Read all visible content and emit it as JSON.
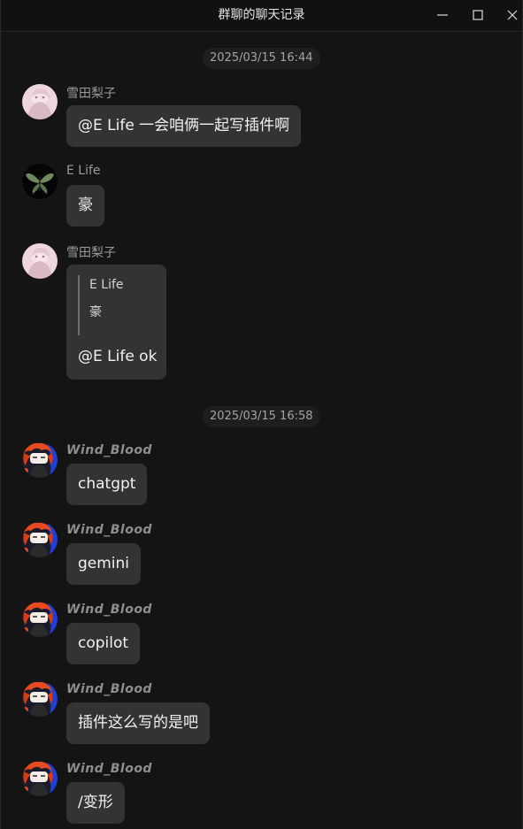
{
  "window": {
    "title": "群聊的聊天记录"
  },
  "timestamps": [
    "2025/03/15 16:44",
    "2025/03/15 16:58"
  ],
  "messages": [
    {
      "sender": "雪田梨子",
      "text": "@E Life 一会咱俩一起写插件啊"
    },
    {
      "sender": "E Life",
      "text": "豪"
    },
    {
      "sender": "雪田梨子",
      "quote_sender": "E Life",
      "quote_text": "豪",
      "text": "@E Life ok"
    },
    {
      "sender": "Wind_Blood",
      "text": "chatgpt"
    },
    {
      "sender": "Wind_Blood",
      "text": "gemini"
    },
    {
      "sender": "Wind_Blood",
      "text": "copilot"
    },
    {
      "sender": "Wind_Blood",
      "text": "插件这么写的是吧"
    },
    {
      "sender": "Wind_Blood",
      "text": "/变形"
    }
  ],
  "icons": {
    "minimize": "minimize-icon",
    "maximize": "maximize-icon",
    "close": "close-icon"
  },
  "colors": {
    "background": "#141414",
    "bubble": "#333333",
    "timestamp_bg": "#1e1e1e"
  }
}
